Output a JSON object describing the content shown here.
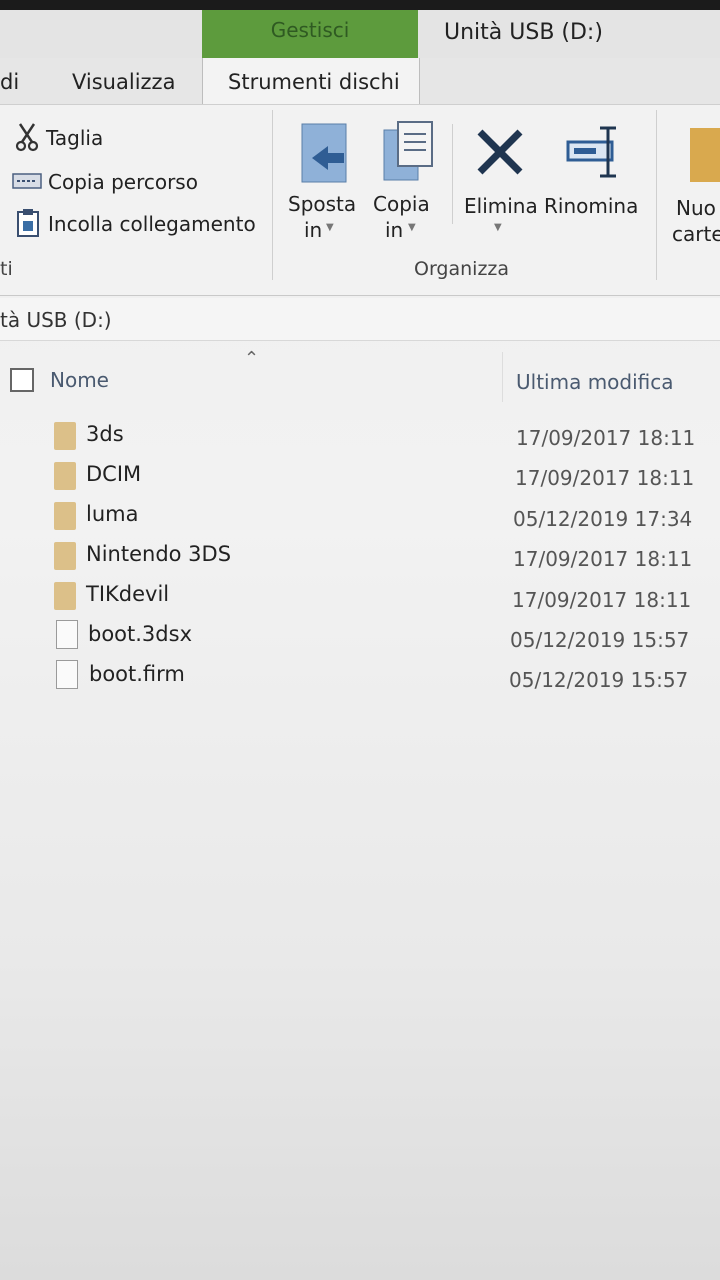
{
  "titlebar": {
    "context_tab": "Gestisci",
    "window_title": "Unità USB (D:)"
  },
  "tabs": [
    {
      "label": "di"
    },
    {
      "label": "Visualizza"
    },
    {
      "label": "Strumenti dischi"
    }
  ],
  "ribbon": {
    "clipboard": {
      "taglia": "Taglia",
      "copia_percorso": "Copia percorso",
      "incolla_collegamento": "Incolla collegamento",
      "group_label": "ti"
    },
    "organizza": {
      "sposta_line1": "Sposta",
      "sposta_line2": "in",
      "copia_line1": "Copia",
      "copia_line2": "in",
      "elimina": "Elimina",
      "rinomina": "Rinomina",
      "group_label": "Organizza"
    },
    "nuovo": {
      "line1": "Nuo",
      "line2": "carte"
    }
  },
  "address": {
    "path": "tà USB (D:)"
  },
  "list": {
    "columns": {
      "name": "Nome",
      "modified": "Ultima modifica"
    },
    "rows": [
      {
        "type": "folder",
        "name": "3ds",
        "date": "17/09/2017 18:11"
      },
      {
        "type": "folder",
        "name": "DCIM",
        "date": "17/09/2017 18:11"
      },
      {
        "type": "folder",
        "name": "luma",
        "date": "05/12/2019 17:34"
      },
      {
        "type": "folder",
        "name": "Nintendo 3DS",
        "date": "17/09/2017 18:11"
      },
      {
        "type": "folder",
        "name": "TIKdevil",
        "date": "17/09/2017 18:11"
      },
      {
        "type": "file",
        "name": "boot.3dsx",
        "date": "05/12/2019 15:57"
      },
      {
        "type": "file",
        "name": "boot.firm",
        "date": "05/12/2019 15:57"
      }
    ]
  },
  "colors": {
    "context_tab_green": "#5d9b3d",
    "folder": "#dcc089",
    "icon_blue": "#3a6ea5",
    "delete_x": "#1f3550"
  }
}
